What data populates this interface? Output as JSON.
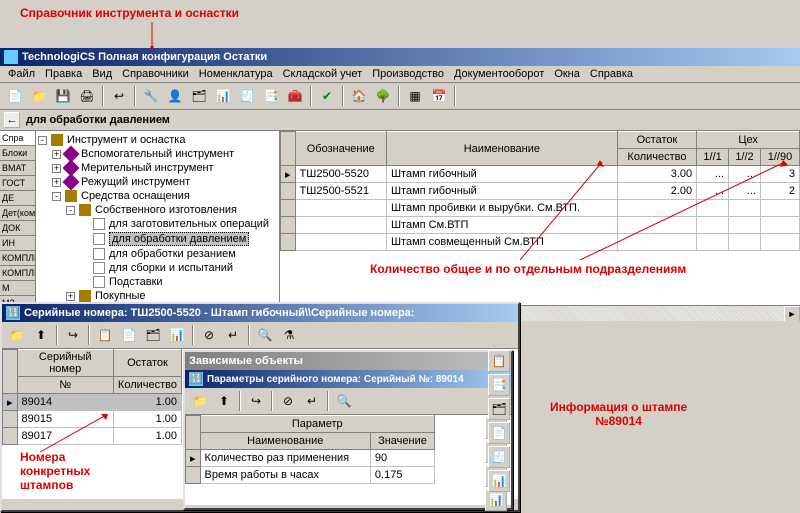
{
  "annotations": {
    "top": "Справочник инструмента и оснастки",
    "right": "Количество общее и по отдельным подразделениям",
    "bottomLeft": "Номера\nконкретных\nштампов",
    "bottomRight": "Информация о штампе\n№89014"
  },
  "mainTitle": "TechnologiCS Полная конфигурация Остатки",
  "menu": [
    "Файл",
    "Правка",
    "Вид",
    "Справочники",
    "Номенклатура",
    "Складской учет",
    "Производство",
    "Документооборот",
    "Окна",
    "Справка"
  ],
  "pathbar": "для обработки давлением",
  "sideTabs": [
    "Спра",
    "Блоки",
    "ВМАТ",
    "ГОСТ",
    "ДЕ",
    "Дет(ком)",
    "ДОК",
    "ИН",
    "КОМПЛЕ",
    "КОМПЛЕ",
    "М",
    "МЗ"
  ],
  "tree": {
    "root": "Инструмент и оснастка",
    "items": [
      {
        "label": "Вспомогательный инструмент",
        "icon": "purple"
      },
      {
        "label": "Мерительный инструмент",
        "icon": "purple"
      },
      {
        "label": "Режущий инструмент",
        "icon": "purple"
      },
      {
        "label": "Средства оснащения",
        "icon": "book",
        "exp": "-",
        "children": [
          {
            "label": "Собственного изготовления",
            "icon": "book",
            "exp": "-",
            "children": [
              {
                "label": "для заготовительных операций",
                "icon": "page"
              },
              {
                "label": "для обработки давлением",
                "icon": "page",
                "sel": true
              },
              {
                "label": "для обработки резанием",
                "icon": "page"
              },
              {
                "label": "для сборки и испытаний",
                "icon": "page"
              },
              {
                "label": "Подставки",
                "icon": "page"
              }
            ]
          },
          {
            "label": "Покупные",
            "icon": "book",
            "exp": "+"
          }
        ]
      }
    ]
  },
  "gridMain": {
    "headers": {
      "obz": "Обозначение",
      "name": "Наименование",
      "ost": "Остаток",
      "ceh": "Цех",
      "qty": "Количество"
    },
    "cehCols": [
      "1//1",
      "1//2",
      "1//90"
    ],
    "rows": [
      {
        "obz": "ТШ2500-5520",
        "name": "Штамп гибочный",
        "qty": "3.00",
        "c1": "...",
        "c2": "...",
        "c3": "3"
      },
      {
        "obz": "ТШ2500-5521",
        "name": "Штамп гибочный",
        "qty": "2.00",
        "c1": "...",
        "c2": "...",
        "c3": "2"
      },
      {
        "obz": "",
        "name": "Штамп пробивки и вырубки. См.ВТП.",
        "qty": "",
        "c1": "",
        "c2": "",
        "c3": ""
      },
      {
        "obz": "",
        "name": "Штамп См.ВТП",
        "qty": "",
        "c1": "",
        "c2": "",
        "c3": ""
      },
      {
        "obz": "",
        "name": "Штамп совмещенный См.ВТП",
        "qty": "",
        "c1": "",
        "c2": "",
        "c3": ""
      }
    ]
  },
  "serialWin": {
    "title": "Серийные номера: ТШ2500-5520 - Штамп гибочный\\\\Серийные номера:",
    "headers": {
      "sn": "Серийный номер",
      "ost": "Остаток",
      "no": "№",
      "qty": "Количество"
    },
    "rows": [
      {
        "no": "89014",
        "qty": "1.00",
        "sel": true
      },
      {
        "no": "89015",
        "qty": "1.00"
      },
      {
        "no": "89017",
        "qty": "1.00"
      }
    ]
  },
  "depWin": {
    "title": "Зависимые объекты",
    "subtitle": "Параметры серийного номера: Серийный №: 89014",
    "headers": {
      "param": "Параметр",
      "name": "Наименование",
      "val": "Значение"
    },
    "rows": [
      {
        "name": "Количество раз применения",
        "val": "90"
      },
      {
        "name": "Время работы в часах",
        "val": "0.175"
      }
    ]
  }
}
